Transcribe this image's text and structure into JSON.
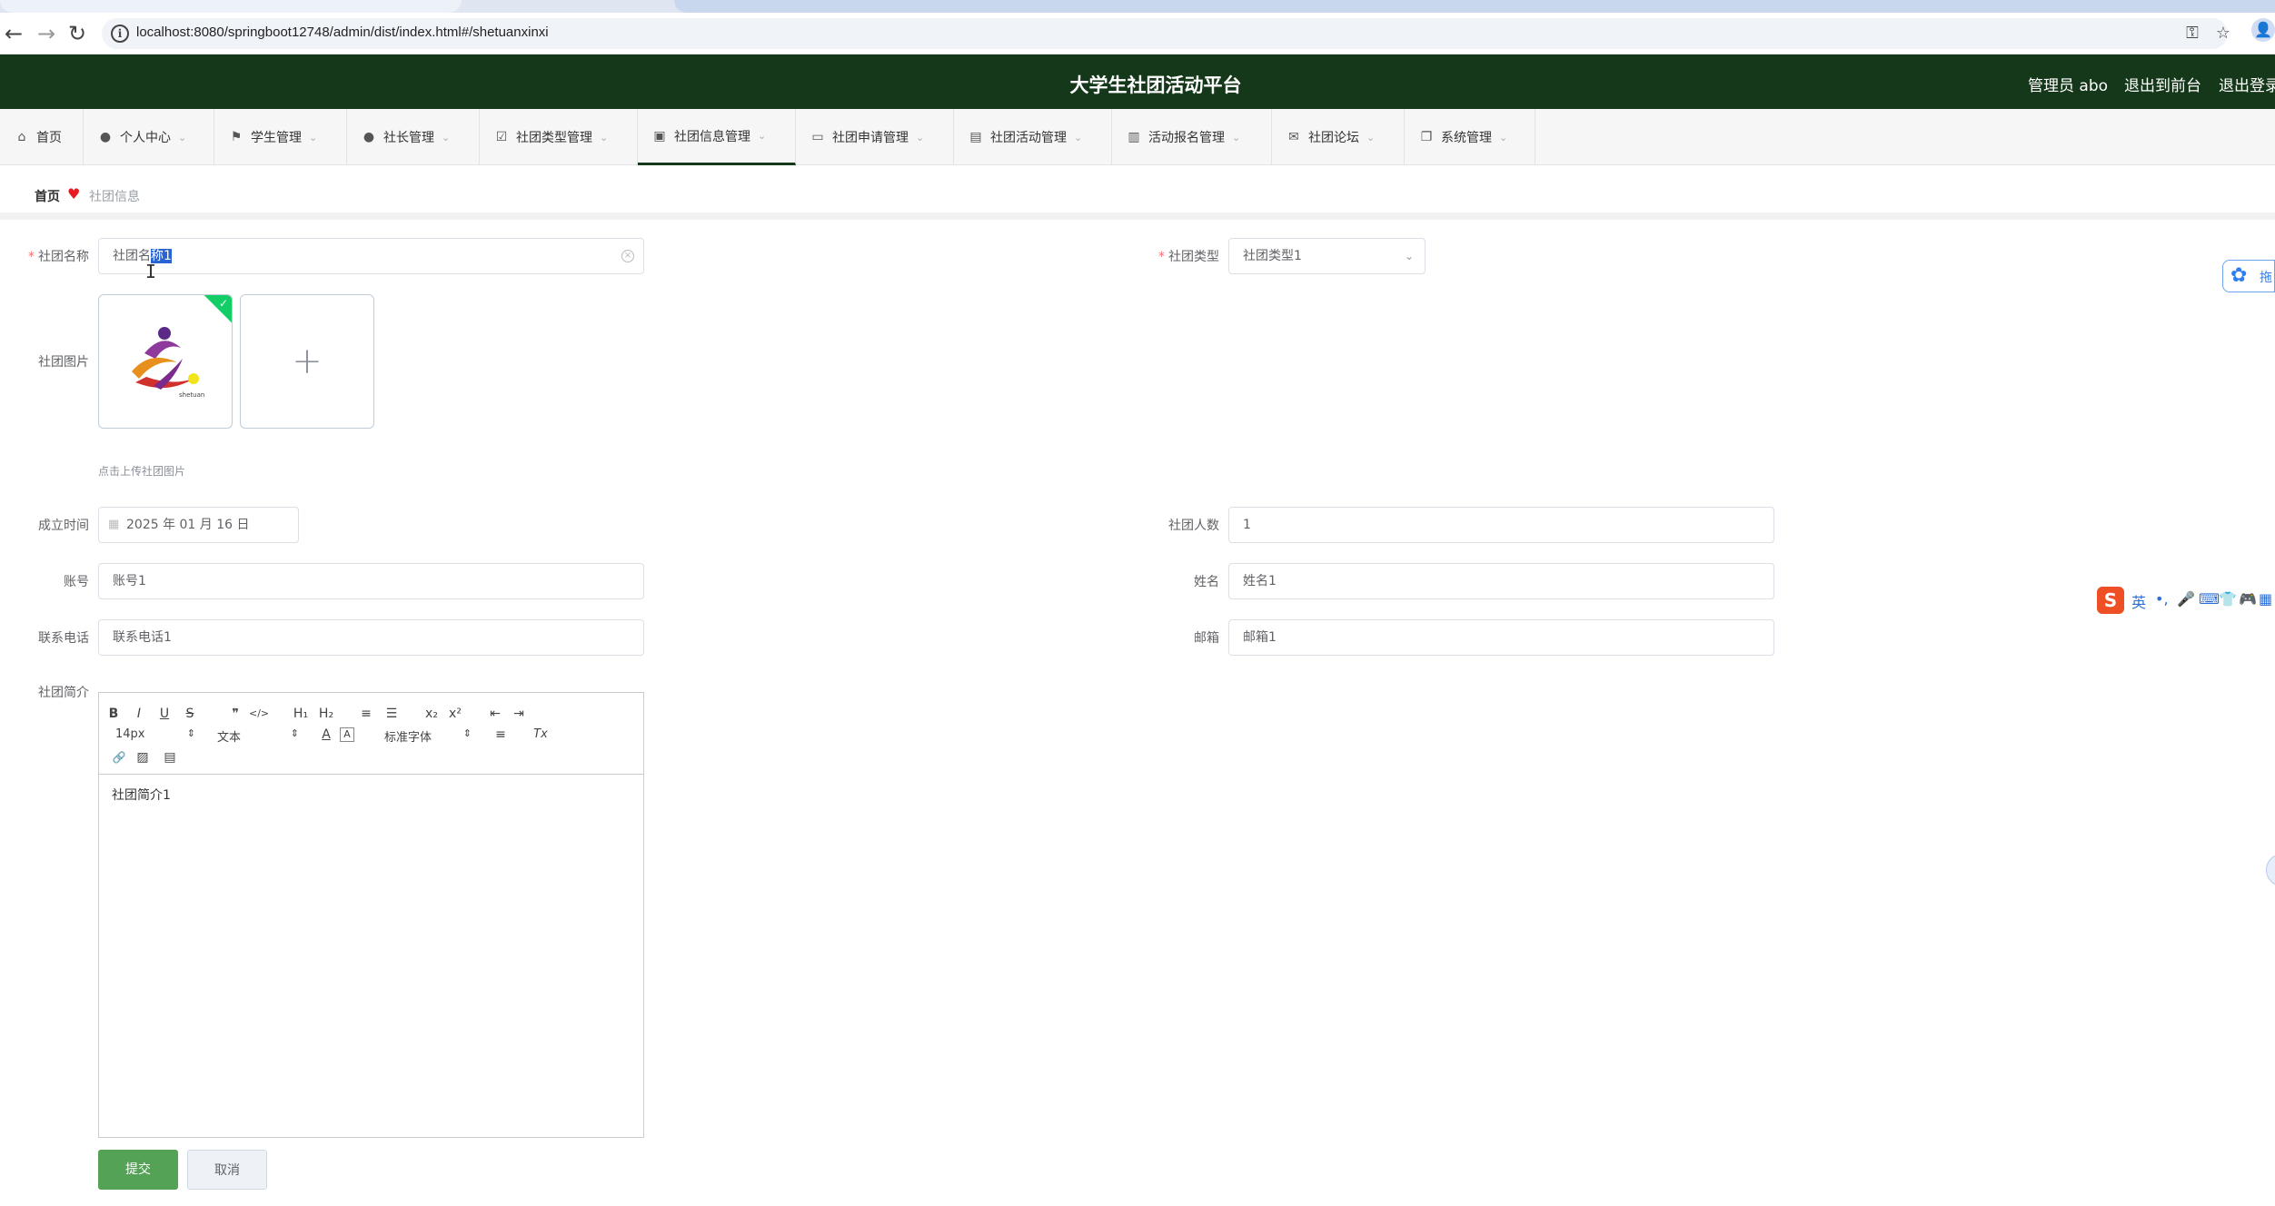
{
  "browser": {
    "url": "localhost:8080/springboot12748/admin/dist/index.html#/shetuanxinxi",
    "back_glyph": "←",
    "forward_glyph": "→",
    "reload_glyph": "↻",
    "info_glyph": "i",
    "key_glyph": "⚿",
    "star_glyph": "☆",
    "profile_glyph": "👤"
  },
  "header": {
    "title": "大学生社团活动平台",
    "user_label": "管理员 abo",
    "front_link": "退出到前台",
    "logout_link": "退出登录"
  },
  "menu": {
    "items": [
      {
        "label": "首页",
        "icon": "home-icon",
        "glyph": "⌂",
        "caret": ""
      },
      {
        "label": "个人中心",
        "icon": "user-icon",
        "glyph": "●",
        "caret": "⌄"
      },
      {
        "label": "学生管理",
        "icon": "flag-icon",
        "glyph": "⚑",
        "caret": "⌄"
      },
      {
        "label": "社长管理",
        "icon": "user-icon",
        "glyph": "●",
        "caret": "⌄"
      },
      {
        "label": "社团类型管理",
        "icon": "checkbox-icon",
        "glyph": "☑",
        "caret": "⌄"
      },
      {
        "label": "社团信息管理",
        "icon": "suitcase-icon",
        "glyph": "▣",
        "caret": "⌄"
      },
      {
        "label": "社团申请管理",
        "icon": "ticket-icon",
        "glyph": "▭",
        "caret": "⌄"
      },
      {
        "label": "社团活动管理",
        "icon": "comment-icon",
        "glyph": "▤",
        "caret": "⌄"
      },
      {
        "label": "活动报名管理",
        "icon": "bar-chart-icon",
        "glyph": "▥",
        "caret": "⌄"
      },
      {
        "label": "社团论坛",
        "icon": "mail-icon",
        "glyph": "✉",
        "caret": "⌄"
      },
      {
        "label": "系统管理",
        "icon": "copy-icon",
        "glyph": "❐",
        "caret": "⌄"
      }
    ]
  },
  "breadcrumb": {
    "home": "首页",
    "heart_glyph": "♥",
    "current": "社团信息"
  },
  "form": {
    "name": {
      "label": "社团名称",
      "value_before": "社团名",
      "value_selected": "称1",
      "clear_glyph": "×",
      "cursor_glyph": "I"
    },
    "type": {
      "label": "社团类型",
      "value": "社团类型1",
      "caret_glyph": "⌄"
    },
    "image": {
      "label": "社团图片",
      "tip": "点击上传社团图片",
      "plus_glyph": "+",
      "check_glyph": "✓",
      "logo_text": "shetuan"
    },
    "founded": {
      "label": "成立时间",
      "value": "2025 年 01 月 16 日",
      "calendar_glyph": "▦"
    },
    "members": {
      "label": "社团人数",
      "value": "1"
    },
    "account": {
      "label": "账号",
      "value": "账号1"
    },
    "person_name": {
      "label": "姓名",
      "value": "姓名1"
    },
    "phone": {
      "label": "联系电话",
      "value": "联系电话1"
    },
    "email": {
      "label": "邮箱",
      "value": "邮箱1"
    },
    "intro": {
      "label": "社团简介",
      "content": "社团简介1"
    },
    "submit_label": "提交",
    "cancel_label": "取消"
  },
  "editor_toolbar": {
    "bold": "B",
    "italic": "I",
    "underline": "U",
    "strike": "S",
    "quote": "❞",
    "code": "</>",
    "h1": "H₁",
    "h2": "H₂",
    "ordered_list": "≡",
    "bullet_list": "☰",
    "subscript": "x₂",
    "superscript": "x²",
    "outdent": "⇤",
    "indent": "⇥",
    "size": "14px",
    "header_picker": "文本",
    "font_color": "A",
    "bg_color": "A",
    "font_picker": "标准字体",
    "align": "≡",
    "clean": "Tx",
    "link": "🔗",
    "image": "▨",
    "video": "▤",
    "picker_arrow": "⇕"
  },
  "widgets": {
    "side_float_glyph": "✿",
    "side_float_text": "拖",
    "ime_logo": "S",
    "ime_lang": "英",
    "ime_punct": "•,",
    "ime_mic": "🎤",
    "ime_keyboard": "⌨",
    "ime_skin": "👕",
    "ime_game": "🎮",
    "ime_apps": "▦"
  },
  "colors": {
    "header_bg": "#15371a",
    "submit_bg": "#54a255",
    "required": "#f56c6c",
    "upload_success": "#13ce66",
    "selection": "#2a64d2"
  }
}
